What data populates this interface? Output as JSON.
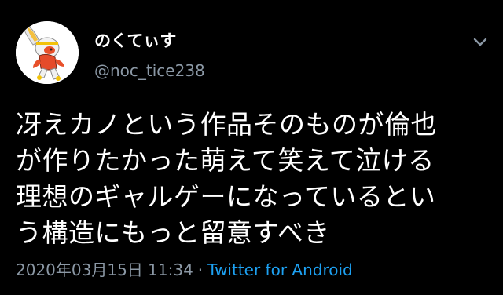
{
  "tweet": {
    "author": {
      "display_name": "のくてぃす",
      "handle": "@noc_tice238",
      "avatar_icon": "character-avatar-icon"
    },
    "menu_icon": "chevron-down-icon",
    "text_lines": [
      "冴えカノという作品そのものが倫也",
      "が作りたかった萌えて笑えて泣ける",
      "理想のギャルゲーになっているとい",
      "う構造にもっと留意すべき"
    ],
    "timestamp": "2020年03月15日 11:34",
    "separator": "·",
    "source": "Twitter for Android"
  },
  "colors": {
    "background": "#000000",
    "text": "#ffffff",
    "secondary": "#8b98a5",
    "link": "#1da1f2"
  }
}
